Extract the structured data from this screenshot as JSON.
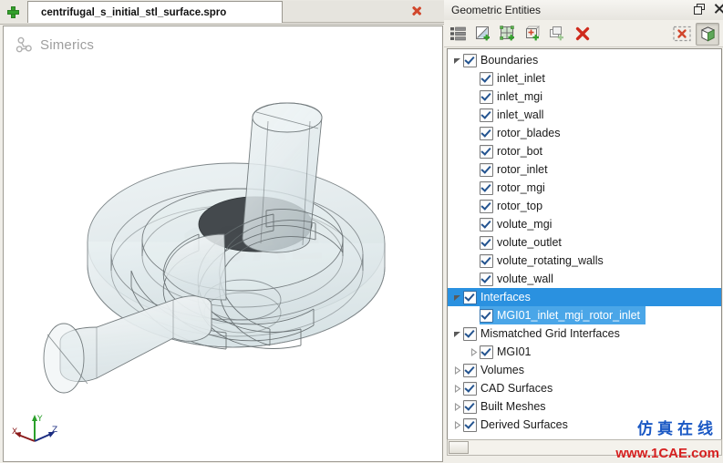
{
  "window": {
    "tab_label": "centrifugal_s_initial_stl_surface.spro",
    "new_tab_icon": "plus-icon",
    "close_tab_icon": "close-icon"
  },
  "viewport": {
    "brand": "Simerics",
    "brand_icon": "simerics-logo-icon",
    "axis": {
      "x": "X",
      "y": "Y",
      "z": "Z"
    },
    "watermark": "1CAE"
  },
  "panel": {
    "title": "Geometric Entities",
    "float_icon": "restore-window-icon",
    "close_icon": "close-icon",
    "toolbar": [
      {
        "name": "list-view-icon",
        "title": "List"
      },
      {
        "name": "add-surface-icon",
        "title": "New Surface"
      },
      {
        "name": "add-patch-icon",
        "title": "New Patch"
      },
      {
        "name": "add-point-icon",
        "title": "New Point"
      },
      {
        "name": "add-copy-icon",
        "title": "Copy"
      },
      {
        "name": "delete-icon",
        "title": "Delete"
      },
      {
        "name": "clear-selection-icon",
        "title": "Clear Selection"
      },
      {
        "name": "view-cube-icon",
        "title": "Show 3D"
      }
    ]
  },
  "tree": [
    {
      "label": "Boundaries",
      "level": 0,
      "expander": "down",
      "checked": true,
      "selected": "none"
    },
    {
      "label": "inlet_inlet",
      "level": 1,
      "expander": "none",
      "checked": true,
      "selected": "none"
    },
    {
      "label": "inlet_mgi",
      "level": 1,
      "expander": "none",
      "checked": true,
      "selected": "none"
    },
    {
      "label": "inlet_wall",
      "level": 1,
      "expander": "none",
      "checked": true,
      "selected": "none"
    },
    {
      "label": "rotor_blades",
      "level": 1,
      "expander": "none",
      "checked": true,
      "selected": "none"
    },
    {
      "label": "rotor_bot",
      "level": 1,
      "expander": "none",
      "checked": true,
      "selected": "none"
    },
    {
      "label": "rotor_inlet",
      "level": 1,
      "expander": "none",
      "checked": true,
      "selected": "none"
    },
    {
      "label": "rotor_mgi",
      "level": 1,
      "expander": "none",
      "checked": true,
      "selected": "none"
    },
    {
      "label": "rotor_top",
      "level": 1,
      "expander": "none",
      "checked": true,
      "selected": "none"
    },
    {
      "label": "volute_mgi",
      "level": 1,
      "expander": "none",
      "checked": true,
      "selected": "none"
    },
    {
      "label": "volute_outlet",
      "level": 1,
      "expander": "none",
      "checked": true,
      "selected": "none"
    },
    {
      "label": "volute_rotating_walls",
      "level": 1,
      "expander": "none",
      "checked": true,
      "selected": "none"
    },
    {
      "label": "volute_wall",
      "level": 1,
      "expander": "none",
      "checked": true,
      "selected": "none"
    },
    {
      "label": "Interfaces",
      "level": 0,
      "expander": "down",
      "checked": true,
      "selected": "full"
    },
    {
      "label": "MGI01_inlet_mgi_rotor_inlet",
      "level": 1,
      "expander": "none",
      "checked": true,
      "selected": "partial"
    },
    {
      "label": "Mismatched Grid Interfaces",
      "level": 0,
      "expander": "down",
      "checked": true,
      "selected": "none"
    },
    {
      "label": "MGI01",
      "level": 1,
      "expander": "right",
      "checked": true,
      "selected": "none"
    },
    {
      "label": "Volumes",
      "level": 0,
      "expander": "right",
      "checked": true,
      "selected": "none"
    },
    {
      "label": "CAD Surfaces",
      "level": 0,
      "expander": "right",
      "checked": true,
      "selected": "none"
    },
    {
      "label": "Built Meshes",
      "level": 0,
      "expander": "right",
      "checked": true,
      "selected": "none"
    },
    {
      "label": "Derived Surfaces",
      "level": 0,
      "expander": "right",
      "checked": true,
      "selected": "none"
    }
  ],
  "watermark": {
    "cn": "仿真在线",
    "url": "www.1CAE.com"
  },
  "colors": {
    "selection_full": "#2a91e0",
    "selection_partial": "#4aa6e8",
    "accent_green": "#33a02c",
    "accent_red": "#d1472c",
    "watermark_blue": "#1a58c4",
    "watermark_red": "#d62020"
  }
}
